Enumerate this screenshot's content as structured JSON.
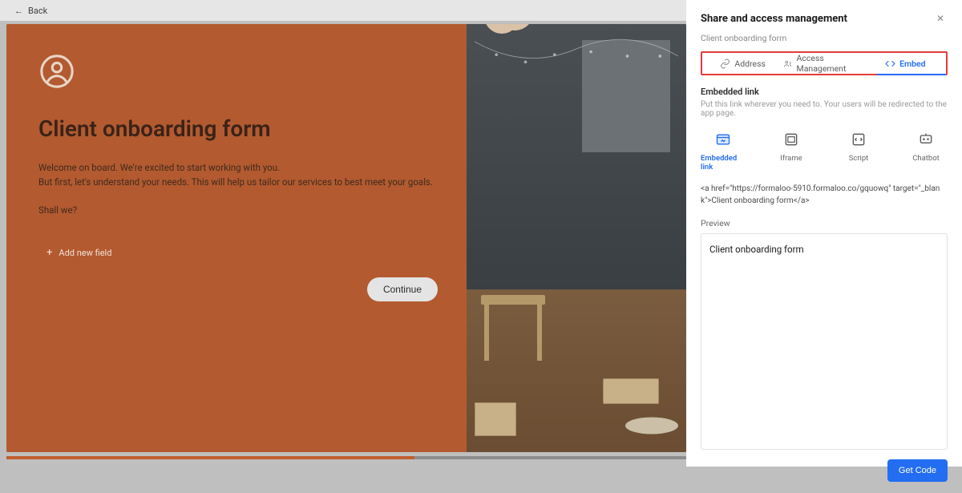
{
  "back_label": "Back",
  "form": {
    "title": "Client onboarding form",
    "welcome_line1": "Welcome on board. We're excited to start working with you.",
    "welcome_line2": "But first, let's understand your needs. This will help us tailor our services to best meet your goals.",
    "shall_we": "Shall we?",
    "add_field_label": "Add new field",
    "continue_label": "Continue"
  },
  "panel": {
    "title": "Share and access management",
    "subtitle": "Client onboarding form",
    "tabs": {
      "address": "Address",
      "access": "Access Management",
      "embed": "Embed"
    },
    "embedded": {
      "title": "Embedded link",
      "desc": "Put this link wherever you need to. Your users will be redirected to the app page.",
      "options": {
        "embedded_link": "Embedded link",
        "iframe": "Iframe",
        "script": "Script",
        "chatbot": "Chatbot"
      },
      "code": "<a href=\"https://formaloo-5910.formaloo.co/gquowq\" target=\"_blank\">Client onboarding form</a>"
    },
    "preview_label": "Preview",
    "preview_link_text": "Client onboarding form",
    "get_code_label": "Get Code"
  }
}
